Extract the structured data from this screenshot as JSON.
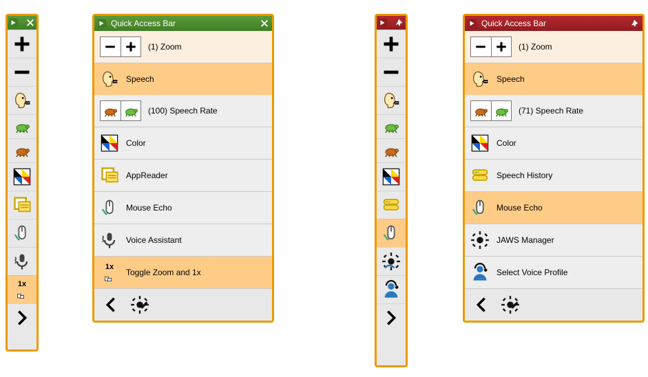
{
  "panelA": {
    "title": "Quick Access Bar",
    "zoom_label": "(1) Zoom",
    "items": [
      {
        "label": "Speech",
        "sel": true
      },
      {
        "label": "(100) Speech Rate",
        "sel": false
      },
      {
        "label": "Color",
        "sel": false
      },
      {
        "label": "AppReader",
        "sel": false
      },
      {
        "label": "Mouse Echo",
        "sel": false
      },
      {
        "label": "Voice Assistant",
        "sel": false
      },
      {
        "label": "Toggle Zoom and 1x",
        "sel": true
      }
    ]
  },
  "panelB": {
    "title": "Quick Access Bar",
    "zoom_label": "(1) Zoom",
    "items": [
      {
        "label": "Speech",
        "sel": true
      },
      {
        "label": "(71) Speech Rate",
        "sel": false
      },
      {
        "label": "Color",
        "sel": false
      },
      {
        "label": "Speech History",
        "sel": false
      },
      {
        "label": "Mouse Echo",
        "sel": true
      },
      {
        "label": "JAWS Manager",
        "sel": false
      },
      {
        "label": "Select Voice Profile",
        "sel": false
      }
    ]
  },
  "vbarA": {
    "onex_label": "1x",
    "sel_index": 8
  },
  "vbarB": {
    "sel_index": 5
  }
}
